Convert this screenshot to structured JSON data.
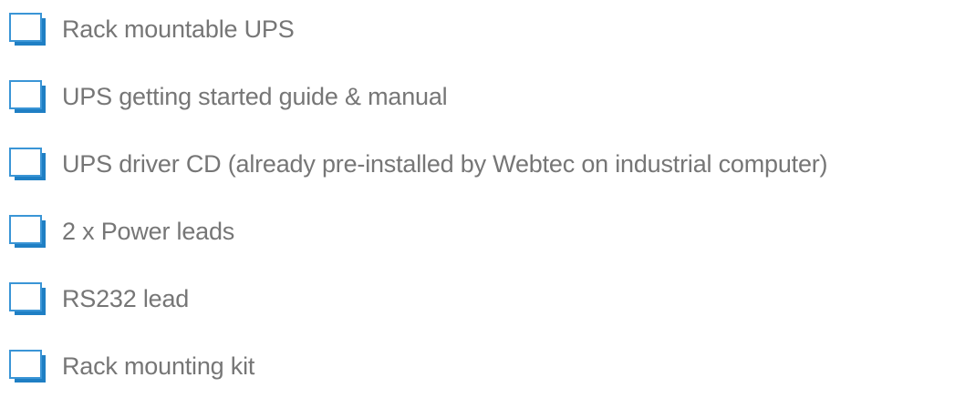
{
  "checklist": {
    "items": [
      {
        "label": "Rack mountable UPS",
        "checked": false
      },
      {
        "label": "UPS getting started guide & manual",
        "checked": false
      },
      {
        "label": "UPS driver CD (already pre-installed by Webtec on industrial computer)",
        "checked": false
      },
      {
        "label": "2 x Power leads",
        "checked": false
      },
      {
        "label": "RS232 lead",
        "checked": false
      },
      {
        "label": "Rack mounting kit",
        "checked": false
      }
    ],
    "colors": {
      "checkbox_accent": "#1f7fc4",
      "checkbox_border": "#3a95d6",
      "text": "#767676"
    }
  }
}
